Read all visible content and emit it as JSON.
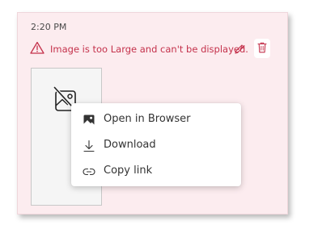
{
  "message": {
    "timestamp": "2:20 PM",
    "error_text": "Image is too Large and can't be displayed."
  },
  "icons": {
    "warning": "warning-triangle-icon",
    "edit": "pencil-icon",
    "delete": "trash-icon",
    "broken_image": "broken-image-icon"
  },
  "context_menu": {
    "items": [
      {
        "label": "Open in Browser",
        "icon": "image-icon"
      },
      {
        "label": "Download",
        "icon": "download-icon"
      },
      {
        "label": "Copy link",
        "icon": "link-icon"
      }
    ]
  },
  "colors": {
    "error": "#c4314b",
    "card_background": "#fcecef"
  }
}
